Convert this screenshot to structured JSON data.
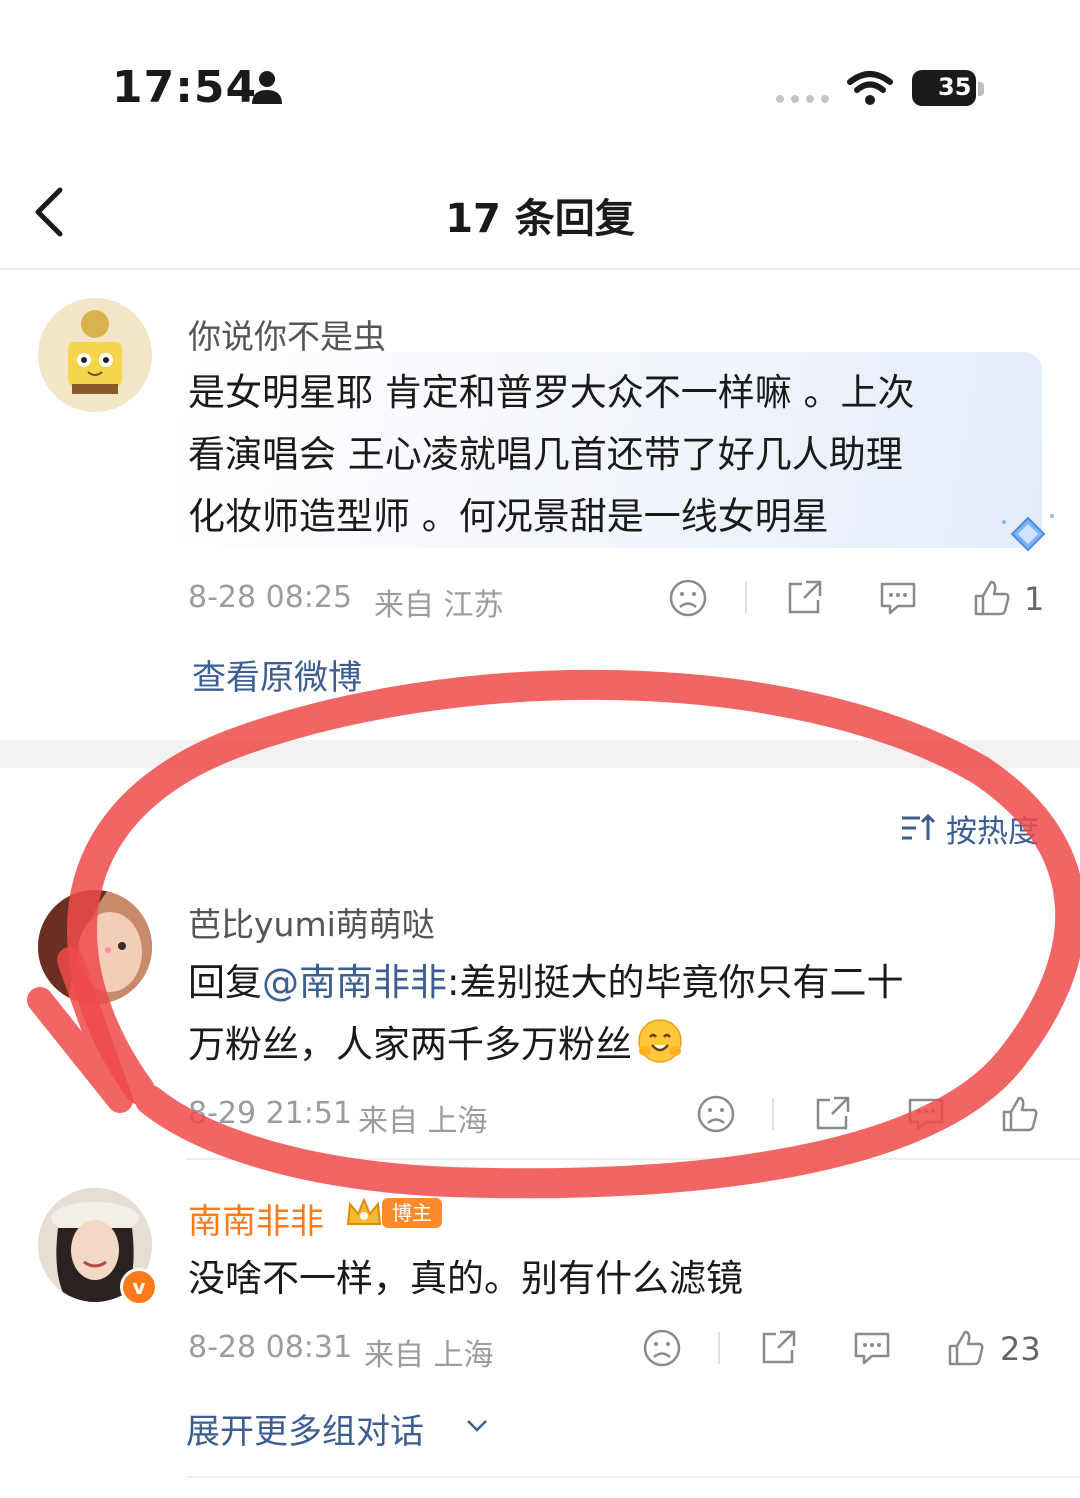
{
  "status_bar": {
    "time": "17:54",
    "battery": "35"
  },
  "nav": {
    "title": "17 条回复"
  },
  "root_comment": {
    "username": "你说你不是虫",
    "lines": [
      "是女明星耶 肯定和普罗大众不一样嘛 。上次",
      "看演唱会 王心凌就唱几首还带了好几人助理",
      "化妆师造型师 。何况景甜是一线女明星"
    ],
    "date": "8-28 08:25",
    "source": "来自 江苏",
    "like_count": "1",
    "view_original": "查看原微博"
  },
  "sort": {
    "label": "按热度"
  },
  "replies": [
    {
      "username": "芭比yumi萌萌哒",
      "prefix": "回复",
      "mention": "@南南非非",
      "line1_rest": ":差别挺大的毕竟你只有二十",
      "line2": "万粉丝，人家两千多万粉丝",
      "emoji": "hugging-face-emoji",
      "date": "8-29 21:51",
      "source": "来自 上海",
      "like_count": ""
    },
    {
      "username": "南南非非",
      "badge": "博主",
      "text": "没啥不一样，真的。别有什么滤镜",
      "date": "8-28 08:31",
      "source": "来自 上海",
      "like_count": "23"
    }
  ],
  "expand_more": "展开更多组对话",
  "colors": {
    "link_blue": "#3c5e93",
    "blogger_orange": "#ff7a1a",
    "annotation_red": "#f04a4a",
    "meta_gray": "#9c9c9c"
  },
  "icons": [
    "person-icon",
    "wifi-icon",
    "back-icon",
    "diamond-icon",
    "dislike-icon",
    "share-icon",
    "comment-icon",
    "like-icon",
    "sort-icon",
    "crown-icon",
    "chevron-down-icon"
  ]
}
